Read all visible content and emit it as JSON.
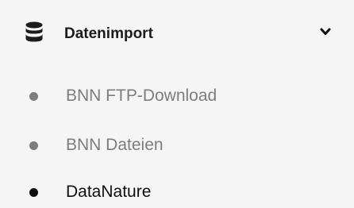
{
  "section": {
    "title": "Datenimport",
    "icon": "database-icon",
    "toggle_icon": "chevron-down-icon"
  },
  "items": [
    {
      "label": "BNN FTP-Download",
      "state": "inactive"
    },
    {
      "label": "BNN Dateien",
      "state": "inactive"
    },
    {
      "label": "DataNature",
      "state": "active"
    }
  ],
  "colors": {
    "background": "#f5f5f5",
    "title": "#1b1b1b",
    "inactive": "#7d7d7d",
    "active": "#0f0f0f"
  }
}
